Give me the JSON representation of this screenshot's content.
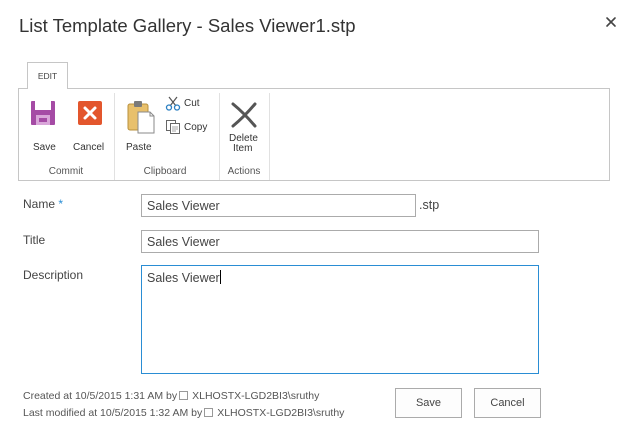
{
  "dialog": {
    "title": "List Template Gallery - Sales Viewer1.stp"
  },
  "ribbon": {
    "tab": "EDIT",
    "groups": {
      "commit": "Commit",
      "clipboard": "Clipboard",
      "actions": "Actions"
    },
    "buttons": {
      "save": "Save",
      "cancel": "Cancel",
      "paste": "Paste",
      "cut": "Cut",
      "copy": "Copy",
      "delete_line1": "Delete",
      "delete_line2": "Item"
    },
    "icons": [
      "save-icon",
      "cancel-icon",
      "paste-icon",
      "cut-icon",
      "copy-icon",
      "delete-item-icon"
    ],
    "colors": {
      "save": "#a54ba5",
      "cancel": "#e3562d"
    }
  },
  "form": {
    "name_label": "Name",
    "required_marker": "*",
    "name_value": "Sales Viewer",
    "name_ext": ".stp",
    "title_label": "Title",
    "title_value": "Sales Viewer",
    "description_label": "Description",
    "description_value": "Sales Viewer"
  },
  "footer": {
    "created": "Created at 10/5/2015 1:31 AM  by",
    "created_by": "XLHOSTX-LGD2BI3\\sruthy",
    "modified": "Last modified at 10/5/2015 1:32 AM  by",
    "modified_by": "XLHOSTX-LGD2BI3\\sruthy",
    "save_button": "Save",
    "cancel_button": "Cancel"
  },
  "colors": {
    "accent": "#2a8dd4"
  }
}
